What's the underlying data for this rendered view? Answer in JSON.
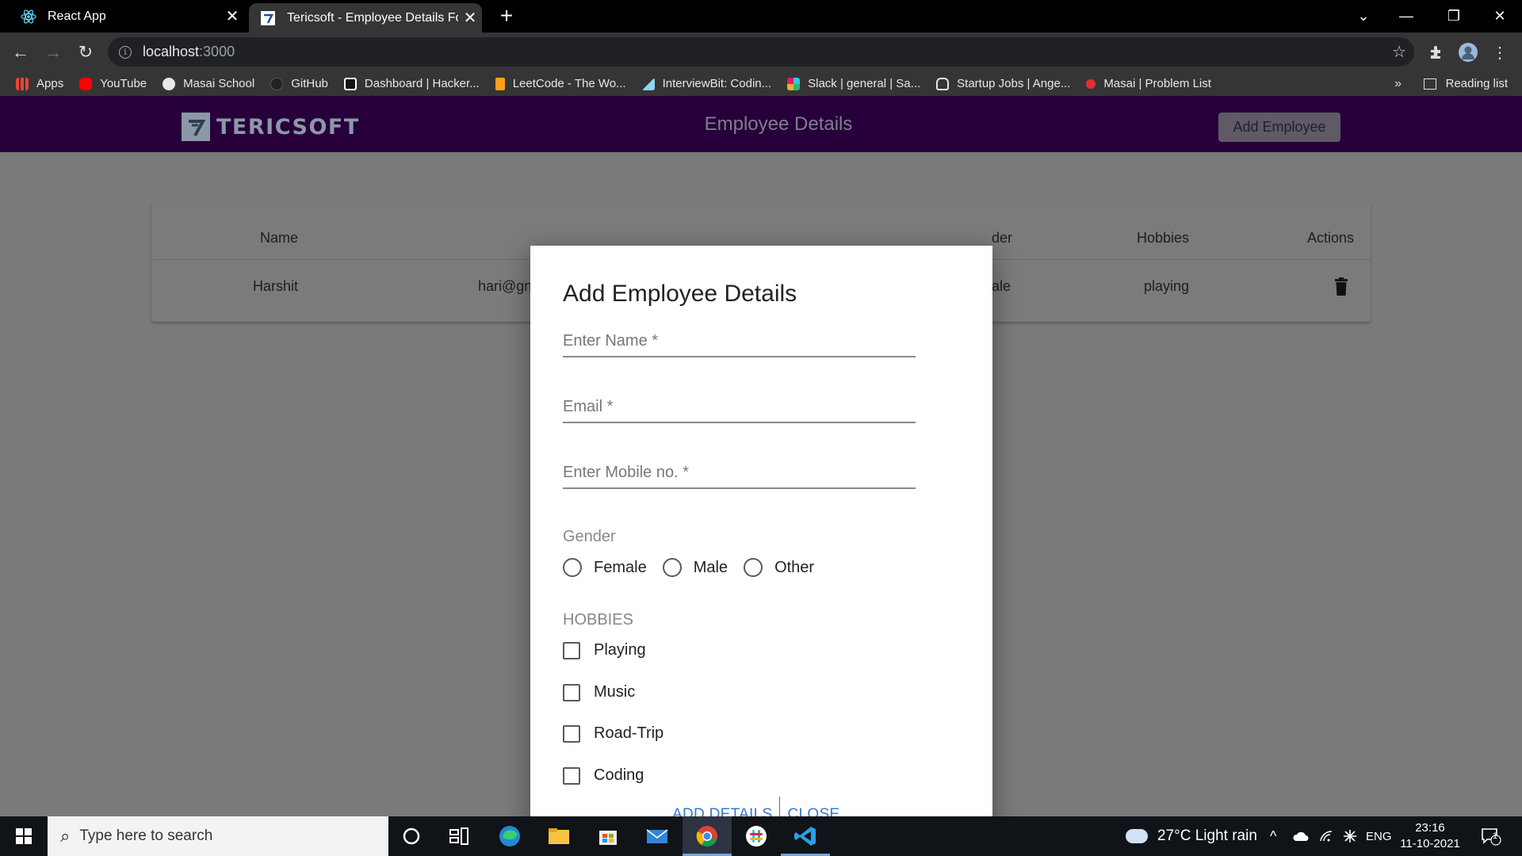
{
  "browser": {
    "tabs": [
      {
        "title": "React App",
        "active": false
      },
      {
        "title": "Tericsoft - Employee Details Form",
        "active": true
      }
    ],
    "url_host": "localhost",
    "url_port": ":3000",
    "bookmarks": [
      {
        "label": "Apps",
        "color": "#4285f4"
      },
      {
        "label": "YouTube",
        "color": "#ff0000"
      },
      {
        "label": "Masai School",
        "color": "#e8e8e8"
      },
      {
        "label": "GitHub",
        "color": "#333333"
      },
      {
        "label": "Dashboard | Hacker...",
        "color": "#2ec866"
      },
      {
        "label": "LeetCode - The Wo...",
        "color": "#f89f1b"
      },
      {
        "label": "InterviewBit: Codin...",
        "color": "#8fd4f0"
      },
      {
        "label": "Slack | general | Sa...",
        "color": "#e01e5a"
      },
      {
        "label": "Startup Jobs | Ange...",
        "color": "#e8e8e8"
      },
      {
        "label": "Masai | Problem List",
        "color": "#e03030"
      }
    ],
    "bookmarks_more": "»",
    "reading_list": "Reading list"
  },
  "app": {
    "logo_text": "TERICSOFT",
    "header_title": "Employee Details",
    "add_employee_label": "Add Employee",
    "table": {
      "headers": [
        "Name",
        "der",
        "Hobbies",
        "Actions"
      ],
      "row": {
        "name": "Harshit",
        "email": "hari@gn",
        "gender": "ale",
        "hobbies": "playing"
      }
    }
  },
  "modal": {
    "title": "Add Employee Details",
    "fields": {
      "name_label": "Enter Name *",
      "email_label": "Email *",
      "mobile_label": "Enter Mobile no. *"
    },
    "gender_label": "Gender",
    "gender_options": [
      "Female",
      "Male",
      "Other"
    ],
    "hobbies_label": "HOBBIES",
    "hobby_options": [
      "Playing",
      "Music",
      "Road-Trip",
      "Coding"
    ],
    "add_details_label": "ADD DETAILS",
    "close_label": "CLOSE"
  },
  "taskbar": {
    "search_placeholder": "Type here to search",
    "weather": "27°C  Light rain",
    "language": "ENG",
    "time": "23:16",
    "date": "11-10-2021",
    "notification_count": "1"
  }
}
